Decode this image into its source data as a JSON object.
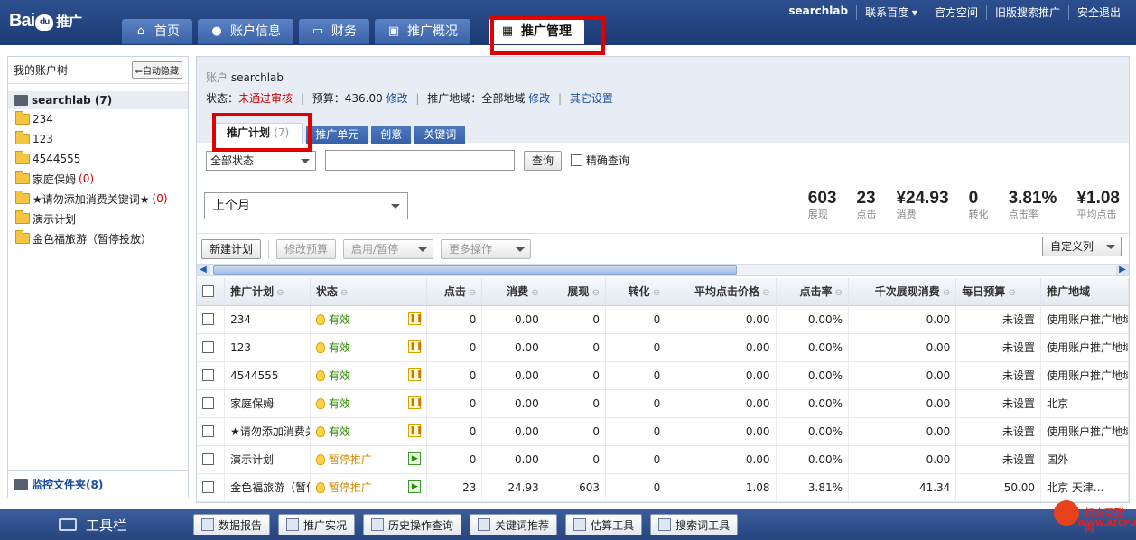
{
  "header": {
    "logo": "Bai",
    "logo_paw": "du",
    "logo_sub": "推广",
    "tabs": [
      {
        "label": "首页",
        "icon": "home-icon",
        "glyph": "⌂"
      },
      {
        "label": "账户信息",
        "icon": "user-icon",
        "glyph": "●"
      },
      {
        "label": "财务",
        "icon": "card-icon",
        "glyph": "▭"
      },
      {
        "label": "推广概况",
        "icon": "chart-icon",
        "glyph": "▣"
      },
      {
        "label": "推广管理",
        "icon": "grid-icon",
        "glyph": "▦"
      }
    ],
    "active_tab": "推广管理",
    "links": [
      "searchlab",
      "联系百度 ▾",
      "官方空间",
      "旧版搜索推广",
      "安全退出"
    ]
  },
  "sidebar": {
    "title": "我的账户树",
    "autohide": "⇐自动隐藏",
    "root": "searchlab (7)",
    "items": [
      {
        "label": "234",
        "count": ""
      },
      {
        "label": "123",
        "count": ""
      },
      {
        "label": "4544555",
        "count": ""
      },
      {
        "label": "家庭保姆",
        "count": "(0)"
      },
      {
        "label": "★请勿添加消费关键词★",
        "count": "(0)"
      },
      {
        "label": "演示计划",
        "count": ""
      },
      {
        "label": "金色福旅游（暂停投放）",
        "count": ""
      }
    ],
    "footer": "监控文件夹(8)"
  },
  "account": {
    "label": "账户",
    "name": "searchlab",
    "status_label": "状态：",
    "status_value": "未通过审核",
    "budget_label": "预算：",
    "budget_value": "436.00",
    "modify": "修改",
    "region_label": "推广地域：",
    "region_value": "全部地域",
    "other": "其它设置"
  },
  "subtabs": {
    "plan": "推广计划",
    "plan_count": "(7)",
    "unit": "推广单元",
    "creative": "创意",
    "keyword": "关键词"
  },
  "filter": {
    "status_select": "全部状态",
    "query": "查询",
    "exact": "精确查询",
    "period": "上个月"
  },
  "stats": [
    {
      "value": "603",
      "label": "展现"
    },
    {
      "value": "23",
      "label": "点击"
    },
    {
      "value": "¥24.93",
      "label": "消费"
    },
    {
      "value": "0",
      "label": "转化"
    },
    {
      "value": "3.81%",
      "label": "点击率"
    },
    {
      "value": "¥1.08",
      "label": "平均点击"
    }
  ],
  "toolbar": {
    "new_plan": "新建计划",
    "modify_budget": "修改预算",
    "enable_pause": "启用/暂停",
    "more": "更多操作",
    "custom_cols": "自定义列"
  },
  "table": {
    "headers": [
      "推广计划",
      "状态",
      "点击",
      "消费",
      "展现",
      "转化",
      "平均点击价格",
      "点击率",
      "千次展现消费",
      "每日预算",
      "推广地域"
    ],
    "rows": [
      {
        "name": "234",
        "status": "有效",
        "paused": false,
        "clicks": "0",
        "cost": "0.00",
        "impr": "0",
        "conv": "0",
        "cpc": "0.00",
        "ctr": "0.00%",
        "cpm": "0.00",
        "budget": "未设置",
        "region": "使用账户推广地域"
      },
      {
        "name": "123",
        "status": "有效",
        "paused": false,
        "clicks": "0",
        "cost": "0.00",
        "impr": "0",
        "conv": "0",
        "cpc": "0.00",
        "ctr": "0.00%",
        "cpm": "0.00",
        "budget": "未设置",
        "region": "使用账户推广地域"
      },
      {
        "name": "4544555",
        "status": "有效",
        "paused": false,
        "clicks": "0",
        "cost": "0.00",
        "impr": "0",
        "conv": "0",
        "cpc": "0.00",
        "ctr": "0.00%",
        "cpm": "0.00",
        "budget": "未设置",
        "region": "使用账户推广地域"
      },
      {
        "name": "家庭保姆",
        "status": "有效",
        "paused": false,
        "clicks": "0",
        "cost": "0.00",
        "impr": "0",
        "conv": "0",
        "cpc": "0.00",
        "ctr": "0.00%",
        "cpm": "0.00",
        "budget": "未设置",
        "region": "北京"
      },
      {
        "name": "★请勿添加消费关键词★",
        "status": "有效",
        "paused": false,
        "clicks": "0",
        "cost": "0.00",
        "impr": "0",
        "conv": "0",
        "cpc": "0.00",
        "ctr": "0.00%",
        "cpm": "0.00",
        "budget": "未设置",
        "region": "使用账户推广地域"
      },
      {
        "name": "演示计划",
        "status": "暂停推广",
        "paused": true,
        "clicks": "0",
        "cost": "0.00",
        "impr": "0",
        "conv": "0",
        "cpc": "0.00",
        "ctr": "0.00%",
        "cpm": "0.00",
        "budget": "未设置",
        "region": "国外"
      },
      {
        "name": "金色福旅游（暂停投放）",
        "status": "暂停推广",
        "paused": true,
        "clicks": "23",
        "cost": "24.93",
        "impr": "603",
        "conv": "0",
        "cpc": "1.08",
        "ctr": "3.81%",
        "cpm": "41.34",
        "budget": "50.00",
        "region": "北京 天津..."
      }
    ]
  },
  "bottombar": {
    "toolbox": "工具栏",
    "buttons": [
      {
        "label": "数据报告",
        "icon": "report-icon"
      },
      {
        "label": "推广实况",
        "icon": "live-icon"
      },
      {
        "label": "历史操作查询",
        "icon": "history-icon"
      },
      {
        "label": "关键词推荐",
        "icon": "keyword-icon"
      },
      {
        "label": "估算工具",
        "icon": "estimate-icon"
      },
      {
        "label": "搜索词工具",
        "icon": "searchword-icon"
      }
    ]
  },
  "watermark": {
    "line1": "灯火互联网",
    "line2": "WWW.ATCPU.COM"
  },
  "colors": {
    "header_bg": "#1c3a75",
    "highlight": "#e00000",
    "status_ok": "#2d8a00",
    "status_paused": "#d48a00",
    "link": "#1a4d99"
  }
}
